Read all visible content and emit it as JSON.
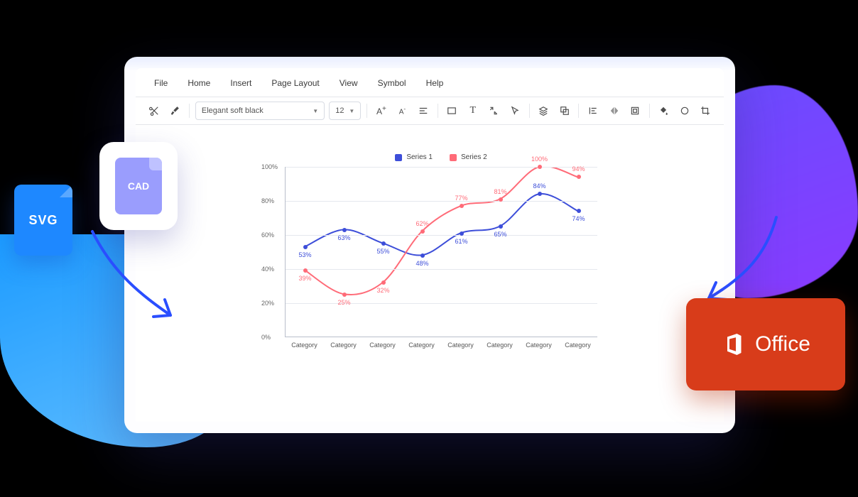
{
  "menu": [
    "File",
    "Home",
    "Insert",
    "Page Layout",
    "View",
    "Symbol",
    "Help"
  ],
  "toolbar": {
    "font_name": "Elegant soft black",
    "font_size": "12"
  },
  "badges": {
    "svg": "SVG",
    "cad": "CAD",
    "office": "Office"
  },
  "chart_data": {
    "type": "line",
    "title": "",
    "xlabel": "",
    "ylabel": "",
    "ylim": [
      0,
      100
    ],
    "y_ticks": [
      0,
      20,
      40,
      60,
      80,
      100
    ],
    "categories": [
      "Category",
      "Category",
      "Category",
      "Category",
      "Category",
      "Category",
      "Category",
      "Category"
    ],
    "series": [
      {
        "name": "Series 1",
        "color": "#3d4ed9",
        "values": [
          53,
          63,
          55,
          48,
          61,
          65,
          84,
          74
        ]
      },
      {
        "name": "Series 2",
        "color": "#ff6b78",
        "values": [
          39,
          25,
          32,
          62,
          77,
          81,
          100,
          94
        ]
      }
    ]
  }
}
